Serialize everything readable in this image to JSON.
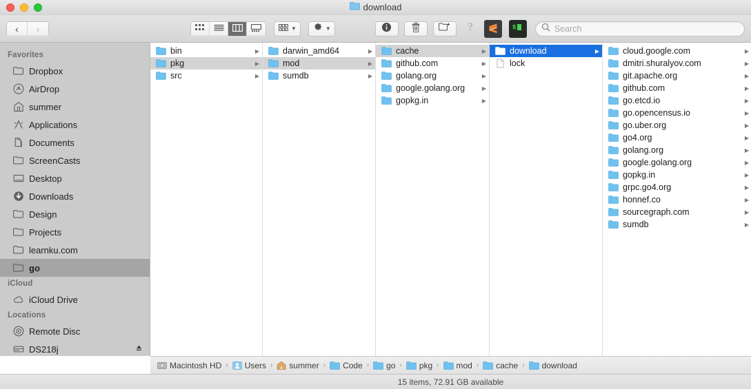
{
  "window": {
    "title": "download",
    "title_icon": "blue-folder-icon",
    "traffic_lights": [
      {
        "name": "close-button",
        "color": "#ff5f57"
      },
      {
        "name": "minimize-button",
        "color": "#febc2e"
      },
      {
        "name": "maximize-button",
        "color": "#28c840"
      }
    ]
  },
  "toolbar": {
    "back_label": "‹",
    "forward_label": "›",
    "view_modes": [
      {
        "name": "icon-view",
        "icon": "grid-icon",
        "active": false
      },
      {
        "name": "list-view",
        "icon": "list-icon",
        "active": false
      },
      {
        "name": "column-view",
        "icon": "columns-icon",
        "active": true
      },
      {
        "name": "gallery-view",
        "icon": "gallery-icon",
        "active": false
      }
    ],
    "arrange_icon": "grid-small-icon",
    "action_icon": "gear-icon",
    "info_icon": "info-icon",
    "delete_icon": "trash-icon",
    "new_folder_icon": "new-folder-icon",
    "help_icon": "question-mark-icon",
    "apps": [
      {
        "name": "sublime-text-icon",
        "glyph": "S",
        "bg": "#3b3b3b",
        "fg": "#ef8733"
      },
      {
        "name": "terminal-icon",
        "glyph": "$",
        "bg": "#252a25",
        "fg": "#45d455"
      }
    ],
    "search": {
      "placeholder": "Search",
      "value": "",
      "icon": "search-icon"
    }
  },
  "sidebar": {
    "sections": [
      {
        "title": "Favorites",
        "items": [
          {
            "label": "Dropbox",
            "icon": "folder-icon",
            "selected": false
          },
          {
            "label": "AirDrop",
            "icon": "airdrop-icon",
            "selected": false
          },
          {
            "label": "summer",
            "icon": "home-icon",
            "selected": false
          },
          {
            "label": "Applications",
            "icon": "applications-icon",
            "selected": false
          },
          {
            "label": "Documents",
            "icon": "documents-icon",
            "selected": false
          },
          {
            "label": "ScreenCasts",
            "icon": "folder-icon",
            "selected": false
          },
          {
            "label": "Desktop",
            "icon": "desktop-icon",
            "selected": false
          },
          {
            "label": "Downloads",
            "icon": "downloads-icon",
            "selected": false
          },
          {
            "label": "Design",
            "icon": "folder-icon",
            "selected": false
          },
          {
            "label": "Projects",
            "icon": "folder-icon",
            "selected": false
          },
          {
            "label": "learnku.com",
            "icon": "folder-icon",
            "selected": false
          },
          {
            "label": "go",
            "icon": "folder-icon",
            "selected": true
          }
        ]
      },
      {
        "title": "iCloud",
        "items": [
          {
            "label": "iCloud Drive",
            "icon": "cloud-icon",
            "selected": false
          }
        ]
      },
      {
        "title": "Locations",
        "items": [
          {
            "label": "Remote Disc",
            "icon": "disc-icon",
            "selected": false
          },
          {
            "label": "DS218j",
            "icon": "nas-icon",
            "selected": false,
            "eject": true
          }
        ]
      }
    ]
  },
  "columns": [
    {
      "name": "column-1",
      "items": [
        {
          "label": "bin",
          "type": "folder",
          "state": "normal",
          "arrow": true
        },
        {
          "label": "pkg",
          "type": "folder",
          "state": "gray",
          "arrow": true
        },
        {
          "label": "src",
          "type": "folder",
          "state": "normal",
          "arrow": true
        }
      ]
    },
    {
      "name": "column-2",
      "items": [
        {
          "label": "darwin_amd64",
          "type": "folder",
          "state": "normal",
          "arrow": true
        },
        {
          "label": "mod",
          "type": "folder",
          "state": "gray",
          "arrow": true
        },
        {
          "label": "sumdb",
          "type": "folder",
          "state": "normal",
          "arrow": true
        }
      ]
    },
    {
      "name": "column-3",
      "items": [
        {
          "label": "cache",
          "type": "folder",
          "state": "gray",
          "arrow": true
        },
        {
          "label": "github.com",
          "type": "folder",
          "state": "normal",
          "arrow": true
        },
        {
          "label": "golang.org",
          "type": "folder",
          "state": "normal",
          "arrow": true
        },
        {
          "label": "google.golang.org",
          "type": "folder",
          "state": "normal",
          "arrow": true
        },
        {
          "label": "gopkg.in",
          "type": "folder",
          "state": "normal",
          "arrow": true
        }
      ]
    },
    {
      "name": "column-4",
      "items": [
        {
          "label": "download",
          "type": "folder",
          "state": "blue",
          "arrow": true
        },
        {
          "label": "lock",
          "type": "file",
          "state": "normal",
          "arrow": false
        }
      ]
    },
    {
      "name": "column-5",
      "items": [
        {
          "label": "cloud.google.com",
          "type": "folder",
          "state": "normal",
          "arrow": true
        },
        {
          "label": "dmitri.shuralyov.com",
          "type": "folder",
          "state": "normal",
          "arrow": true
        },
        {
          "label": "git.apache.org",
          "type": "folder",
          "state": "normal",
          "arrow": true
        },
        {
          "label": "github.com",
          "type": "folder",
          "state": "normal",
          "arrow": true
        },
        {
          "label": "go.etcd.io",
          "type": "folder",
          "state": "normal",
          "arrow": true
        },
        {
          "label": "go.opencensus.io",
          "type": "folder",
          "state": "normal",
          "arrow": true
        },
        {
          "label": "go.uber.org",
          "type": "folder",
          "state": "normal",
          "arrow": true
        },
        {
          "label": "go4.org",
          "type": "folder",
          "state": "normal",
          "arrow": true
        },
        {
          "label": "golang.org",
          "type": "folder",
          "state": "normal",
          "arrow": true
        },
        {
          "label": "google.golang.org",
          "type": "folder",
          "state": "normal",
          "arrow": true
        },
        {
          "label": "gopkg.in",
          "type": "folder",
          "state": "normal",
          "arrow": true
        },
        {
          "label": "grpc.go4.org",
          "type": "folder",
          "state": "normal",
          "arrow": true
        },
        {
          "label": "honnef.co",
          "type": "folder",
          "state": "normal",
          "arrow": true
        },
        {
          "label": "sourcegraph.com",
          "type": "folder",
          "state": "normal",
          "arrow": true
        },
        {
          "label": "sumdb",
          "type": "folder",
          "state": "normal",
          "arrow": true
        }
      ]
    }
  ],
  "pathbar": {
    "crumbs": [
      {
        "label": "Macintosh HD",
        "icon": "harddisk-icon"
      },
      {
        "label": "Users",
        "icon": "users-folder-icon"
      },
      {
        "label": "summer",
        "icon": "home-icon"
      },
      {
        "label": "Code",
        "icon": "folder-icon"
      },
      {
        "label": "go",
        "icon": "folder-icon"
      },
      {
        "label": "pkg",
        "icon": "folder-icon"
      },
      {
        "label": "mod",
        "icon": "folder-icon"
      },
      {
        "label": "cache",
        "icon": "folder-icon"
      },
      {
        "label": "download",
        "icon": "folder-icon"
      }
    ],
    "separator": "›"
  },
  "statusbar": {
    "text": "15 items, 72.91 GB available"
  },
  "colors": {
    "selection_blue": "#1a6fe0",
    "selection_gray": "#d4d4d4",
    "sidebar_bg": "#cbcbcb",
    "folder_blue": "#6fc2f0"
  }
}
